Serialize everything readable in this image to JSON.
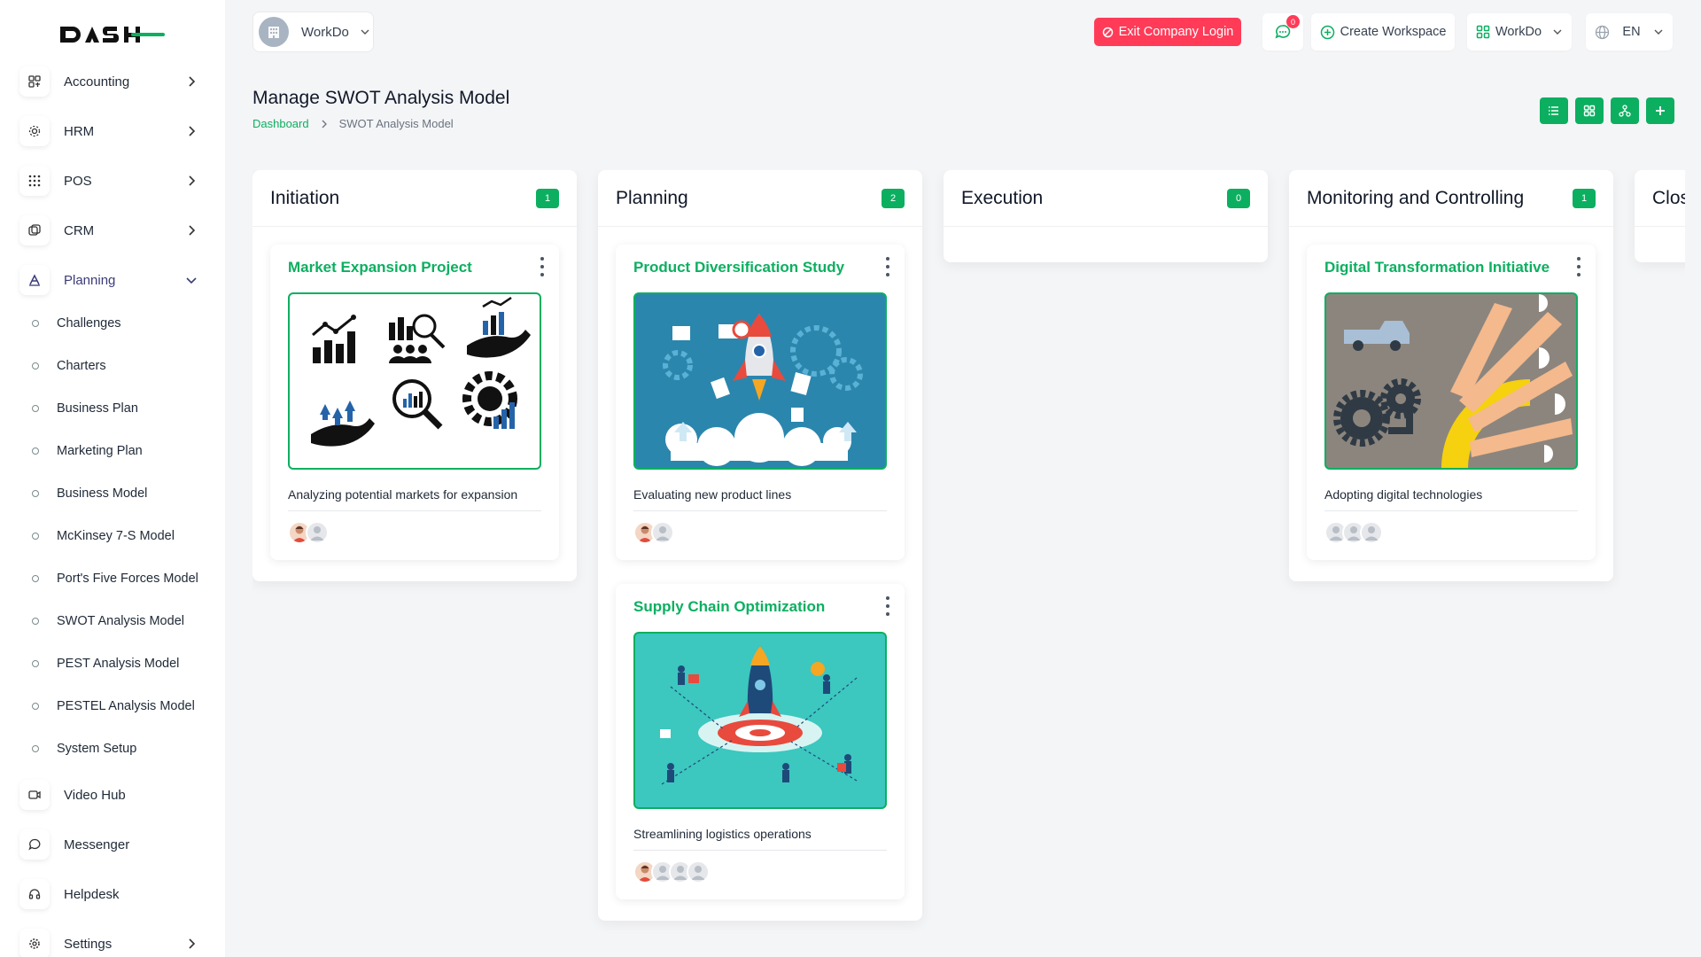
{
  "brand": {
    "logo_text": "DASH"
  },
  "sidebar": {
    "items": [
      {
        "label": "Accounting",
        "icon": "accounting-icon"
      },
      {
        "label": "HRM",
        "icon": "hrm-icon"
      },
      {
        "label": "POS",
        "icon": "pos-icon"
      },
      {
        "label": "CRM",
        "icon": "crm-icon"
      },
      {
        "label": "Planning",
        "icon": "planning-icon"
      },
      {
        "label": "Video Hub",
        "icon": "video-icon"
      },
      {
        "label": "Messenger",
        "icon": "messenger-icon"
      },
      {
        "label": "Helpdesk",
        "icon": "helpdesk-icon"
      },
      {
        "label": "Settings",
        "icon": "settings-icon"
      }
    ],
    "planning_sub": [
      "Challenges",
      "Charters",
      "Business Plan",
      "Marketing Plan",
      "Business Model",
      "McKinsey 7-S Model",
      "Port's Five Forces Model",
      "SWOT Analysis Model",
      "PEST Analysis Model",
      "PESTEL Analysis Model",
      "System Setup"
    ]
  },
  "topbar": {
    "workspace_switch": "WorkDo",
    "exit_label": "Exit Company Login",
    "messages_count": "0",
    "create_workspace": "Create Workspace",
    "workspace_dropdown": "WorkDo",
    "language": "EN"
  },
  "page": {
    "title": "Manage SWOT Analysis Model",
    "breadcrumb_home": "Dashboard",
    "breadcrumb_current": "SWOT Analysis Model"
  },
  "columns": [
    {
      "title": "Initiation",
      "count": "1"
    },
    {
      "title": "Planning",
      "count": "2"
    },
    {
      "title": "Execution",
      "count": "0"
    },
    {
      "title": "Monitoring and Controlling",
      "count": "1"
    },
    {
      "title": "Clos"
    }
  ],
  "cards": {
    "market": {
      "title": "Market Expansion Project",
      "desc": "Analyzing potential markets for expansion"
    },
    "product": {
      "title": "Product Diversification Study",
      "desc": "Evaluating new product lines"
    },
    "supply": {
      "title": "Supply Chain Optimization",
      "desc": "Streamlining logistics operations"
    },
    "digital": {
      "title": "Digital Transformation Initiative",
      "desc": "Adopting digital technologies"
    }
  },
  "colors": {
    "accent": "#0caf60",
    "danger": "#ff3b58"
  }
}
